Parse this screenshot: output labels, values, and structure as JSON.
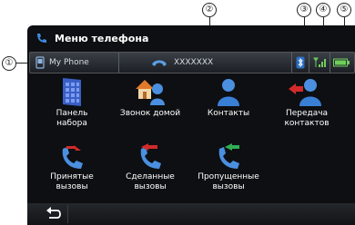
{
  "callouts": [
    "①",
    "②",
    "③",
    "④",
    "⑤"
  ],
  "title": "Меню телефона",
  "status": {
    "device": "My Phone",
    "number": "XXXXXXX",
    "icons": [
      "bluetooth-icon",
      "signal-strength-icon",
      "battery-icon"
    ]
  },
  "tiles": [
    {
      "line1": "Панель",
      "line2": "набора",
      "icon": "keypad-icon"
    },
    {
      "line1": "Звонок домой",
      "line2": "",
      "icon": "call-home-icon"
    },
    {
      "line1": "Контакты",
      "line2": "",
      "icon": "contacts-icon"
    },
    {
      "line1": "Передача",
      "line2": "контактов",
      "icon": "transfer-contacts-icon"
    },
    {
      "line1": "Принятые",
      "line2": "вызовы",
      "icon": "received-calls-icon"
    },
    {
      "line1": "Сделанные",
      "line2": "вызовы",
      "icon": "dialed-calls-icon"
    },
    {
      "line1": "Пропущенные",
      "line2": "вызовы",
      "icon": "missed-calls-icon"
    }
  ],
  "colors": {
    "accent": "#2f7fd6",
    "background": "#0d0f12",
    "missed": "#2fae55",
    "outgoing": "#d22a2a"
  }
}
